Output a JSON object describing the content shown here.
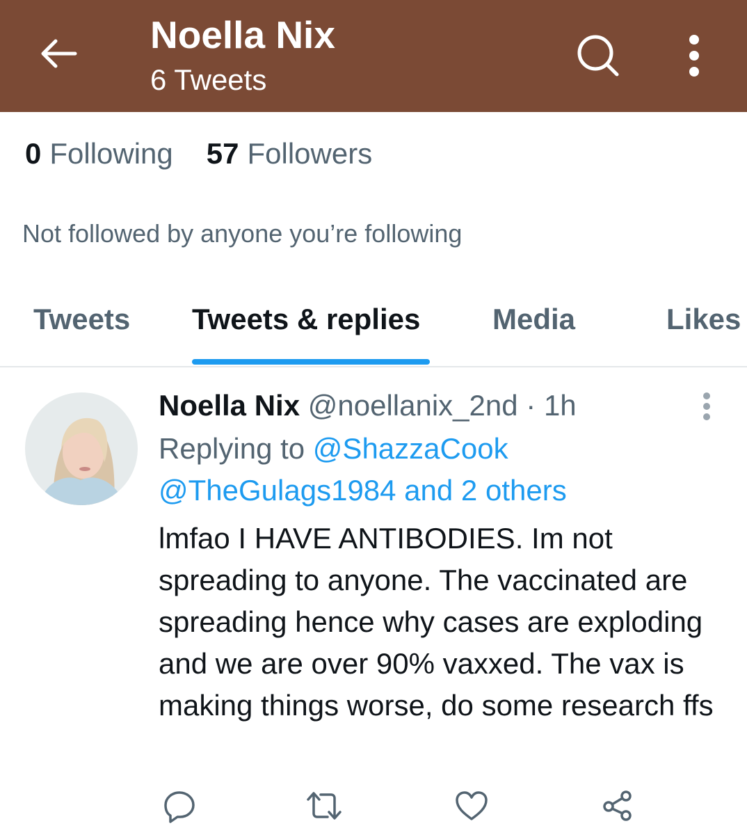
{
  "header": {
    "title": "Noella Nix",
    "subtitle": "6 Tweets",
    "bg_color": "#7b4a35",
    "icons": [
      "arrow-left-icon",
      "search-icon",
      "more-vertical-icon"
    ]
  },
  "profile": {
    "following_count": "0",
    "following_label": "Following",
    "followers_count": "57",
    "followers_label": "Followers",
    "not_followed_text": "Not followed by anyone you’re following"
  },
  "tabs": [
    {
      "label": "Tweets",
      "active": false
    },
    {
      "label": "Tweets & replies",
      "active": true
    },
    {
      "label": "Media",
      "active": false
    },
    {
      "label": "Likes",
      "active": false
    }
  ],
  "tweet": {
    "author_name": "Noella Nix",
    "handle": "@noellanix_2nd",
    "separator": "·",
    "time": "1h",
    "replying_prefix": "Replying to",
    "reply_to_1": "@ShazzaCook",
    "reply_to_2": "@TheGulags1984 and 2 others",
    "text": "lmfao I HAVE ANTIBODIES. Im not spreading to anyone. The vaccinated are spreading hence why cases are exploding and we are over 90% vaxxed. The vax is making things worse, do some research ffs",
    "actions": [
      "reply-icon",
      "retweet-icon",
      "like-icon",
      "share-icon"
    ]
  },
  "colors": {
    "accent": "#1d9bf0",
    "muted_text": "#536471",
    "primary_text": "#0f1419"
  }
}
